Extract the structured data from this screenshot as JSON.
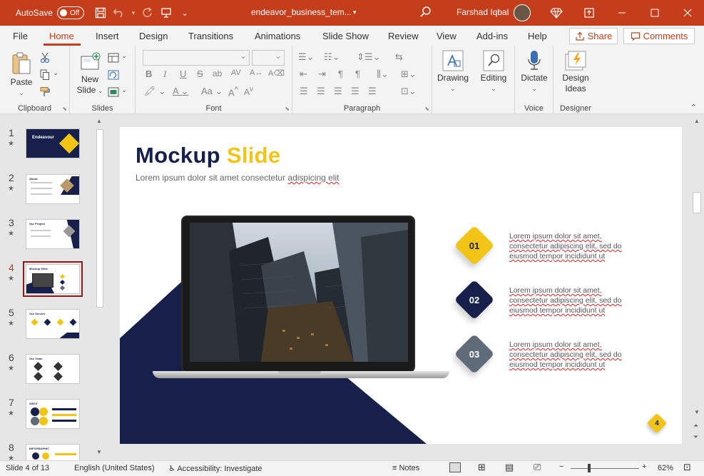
{
  "titlebar": {
    "autosave_label": "AutoSave",
    "autosave_state": "Off",
    "document_title": "endeavor_business_tem...",
    "user_name": "Farshad Iqbal"
  },
  "tabs": [
    {
      "label": "File"
    },
    {
      "label": "Home",
      "active": true
    },
    {
      "label": "Insert"
    },
    {
      "label": "Design"
    },
    {
      "label": "Transitions"
    },
    {
      "label": "Animations"
    },
    {
      "label": "Slide Show"
    },
    {
      "label": "Review"
    },
    {
      "label": "View"
    },
    {
      "label": "Add-ins"
    },
    {
      "label": "Help"
    }
  ],
  "share_label": "Share",
  "comments_label": "Comments",
  "ribbon": {
    "groups": {
      "clipboard": "Clipboard",
      "slides": "Slides",
      "font": "Font",
      "paragraph": "Paragraph",
      "voice": "Voice",
      "designer": "Designer"
    },
    "paste": "Paste",
    "new_slide_1": "New",
    "new_slide_2": "Slide",
    "drawing": "Drawing",
    "editing": "Editing",
    "dictate": "Dictate",
    "design_ideas_1": "Design",
    "design_ideas_2": "Ideas"
  },
  "thumbnails": [
    {
      "num": "1",
      "title": "Endeavour"
    },
    {
      "num": "2",
      "title": "About"
    },
    {
      "num": "3",
      "title": "Our Project"
    },
    {
      "num": "4",
      "title": "Mockup Slide",
      "selected": true
    },
    {
      "num": "5",
      "title": "Our Service"
    },
    {
      "num": "6",
      "title": "Our Team"
    },
    {
      "num": "7",
      "title": "SWOT"
    },
    {
      "num": "8",
      "title": "INFOGRAPHIC"
    }
  ],
  "slide": {
    "title_main": "Mockup",
    "title_accent": "Slide",
    "subtitle_a": "Lorem ipsum dolor sit amet consectetur ",
    "subtitle_b": "adispicing elit",
    "items": [
      {
        "num": "01",
        "line1": "Lorem ipsum dolor sit amet,",
        "line2": "consectetur adipiscing elit, sed do",
        "line3": "eiusmod tempor incididunt ut"
      },
      {
        "num": "02",
        "line1": "Lorem ipsum dolor sit amet,",
        "line2": "consectetur adipiscing elit, sed do",
        "line3": "eiusmod tempor incididunt ut"
      },
      {
        "num": "03",
        "line1": "Lorem ipsum dolor sit amet,",
        "line2": "consectetur adipiscing elit, sed do",
        "line3": "eiusmod tempor incididunt ut"
      }
    ],
    "page_number": "4",
    "colors": {
      "navy": "#16204a",
      "gold": "#f2c416",
      "slate": "#5f6b78"
    }
  },
  "statusbar": {
    "slide_info": "Slide 4 of 13",
    "language": "English (United States)",
    "accessibility": "Accessibility: Investigate",
    "notes": "Notes",
    "zoom": "62%"
  }
}
